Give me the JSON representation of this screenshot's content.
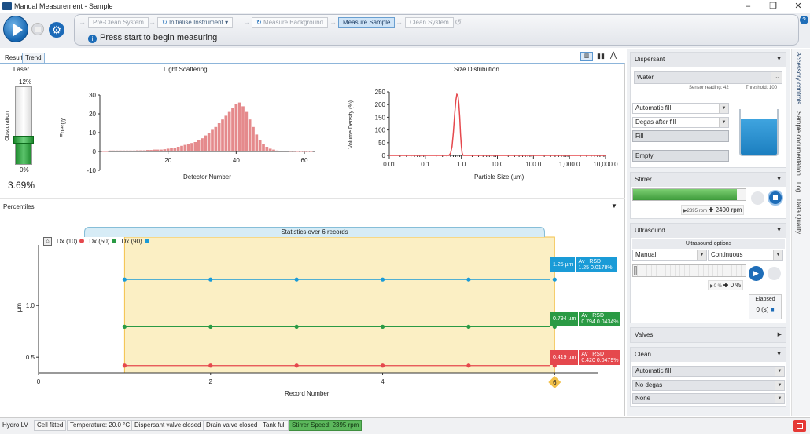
{
  "window": {
    "title": "Manual Measurement - Sample"
  },
  "workflow": {
    "steps": [
      "Pre-Clean System",
      "Initialise Instrument",
      "Measure Background",
      "Measure Sample",
      "Clean System"
    ],
    "active_step": "Measure Sample",
    "instruction": "Press start to begin measuring"
  },
  "tabs": {
    "result": "Result",
    "trend": "Trend"
  },
  "laser": {
    "title": "Laser",
    "top_pct": "12%",
    "bottom_pct": "0%",
    "obscuration_label": "Obscuration",
    "value": "3.69%",
    "level": 0.3075
  },
  "light_scattering": {
    "title": "Light Scattering",
    "ylabel": "Energy",
    "xlabel": "Detector Number"
  },
  "size_distribution": {
    "title": "Size Distribution",
    "ylabel": "Volume Density (%)",
    "xlabel": "Particle Size (µm)"
  },
  "percentiles": {
    "title": "Percentiles",
    "banner": "Statistics over 6 records",
    "legend": [
      "Dx (10)",
      "Dx (50)",
      "Dx (90)"
    ],
    "xlabel": "Record Number",
    "ylabel": "µm",
    "marker_label": "6",
    "stats": [
      {
        "value": "1.25 µm",
        "av_label": "Av",
        "rsd_label": "RSD",
        "av": "1.25",
        "rsd": "0.0178%",
        "color": "#1a9bd7"
      },
      {
        "value": "0.794 µm",
        "av_label": "Av",
        "rsd_label": "RSD",
        "av": "0.794",
        "rsd": "0.0434%",
        "color": "#2a9a44"
      },
      {
        "value": "0.419 µm",
        "av_label": "Av",
        "rsd_label": "RSD",
        "av": "0.420",
        "rsd": "0.0479%",
        "color": "#e5484d"
      }
    ]
  },
  "chart_data": [
    {
      "type": "bar",
      "title": "Light Scattering",
      "xlabel": "Detector Number",
      "ylabel": "Energy",
      "xlim": [
        0,
        63
      ],
      "ylim": [
        -10,
        30
      ],
      "xticks": [
        20,
        40,
        60
      ],
      "yticks": [
        -10,
        0,
        10,
        20,
        30
      ],
      "x": [
        1,
        2,
        3,
        4,
        5,
        6,
        7,
        8,
        9,
        10,
        11,
        12,
        13,
        14,
        15,
        16,
        17,
        18,
        19,
        20,
        21,
        22,
        23,
        24,
        25,
        26,
        27,
        28,
        29,
        30,
        31,
        32,
        33,
        34,
        35,
        36,
        37,
        38,
        39,
        40,
        41,
        42,
        43,
        44,
        45,
        46,
        47,
        48,
        49,
        50,
        51,
        52,
        53,
        54,
        55,
        56,
        57,
        58,
        59,
        60,
        61,
        62
      ],
      "values": [
        0,
        0,
        0.5,
        0.5,
        0.5,
        0.5,
        0.5,
        0.5,
        0.5,
        0.5,
        0.6,
        0.6,
        0.6,
        0.8,
        0.8,
        1,
        1,
        1,
        1.2,
        1.5,
        2,
        2,
        2.5,
        3,
        3.5,
        4,
        4.5,
        5,
        6,
        7,
        8.5,
        10,
        11.5,
        13,
        15,
        17,
        19,
        21,
        23,
        25,
        26,
        24,
        21,
        17,
        13,
        9,
        6,
        4,
        2.5,
        1.5,
        1,
        0.5,
        0.3,
        0.2,
        0.2,
        0.1,
        0.1,
        0,
        0,
        0,
        0,
        0
      ]
    },
    {
      "type": "line",
      "title": "Size Distribution",
      "xlabel": "Particle Size (µm)",
      "ylabel": "Volume Density (%)",
      "xscale": "log",
      "xlim": [
        0.01,
        10000
      ],
      "ylim": [
        0,
        250
      ],
      "xticks": [
        "0.01",
        "0.1",
        "1.0",
        "10.0",
        "100.0",
        "1,000.0",
        "10,000.0"
      ],
      "yticks": [
        0,
        50,
        100,
        150,
        200,
        250
      ],
      "x": [
        0.45,
        0.5,
        0.55,
        0.6,
        0.65,
        0.7,
        0.75,
        0.8,
        0.85,
        0.9,
        0.95,
        1.0,
        1.05,
        1.1,
        1.15
      ],
      "values": [
        0,
        8,
        35,
        90,
        160,
        215,
        240,
        238,
        205,
        150,
        85,
        35,
        10,
        2,
        0
      ]
    },
    {
      "type": "line",
      "title": "Percentiles",
      "xlabel": "Record Number",
      "ylabel": "µm",
      "xlim": [
        0,
        6.5
      ],
      "ylim": [
        0.35,
        1.6
      ],
      "xticks": [
        0,
        2,
        4,
        6
      ],
      "yticks": [
        0.5,
        1.0
      ],
      "x": [
        1,
        2,
        3,
        4,
        5,
        6
      ],
      "series": [
        {
          "name": "Dx (10)",
          "color": "#e5484d",
          "values": [
            0.42,
            0.42,
            0.42,
            0.42,
            0.42,
            0.42
          ]
        },
        {
          "name": "Dx (50)",
          "color": "#2a9a44",
          "values": [
            0.794,
            0.794,
            0.794,
            0.794,
            0.794,
            0.794
          ]
        },
        {
          "name": "Dx (90)",
          "color": "#1a9bd7",
          "values": [
            1.25,
            1.25,
            1.25,
            1.25,
            1.25,
            1.25
          ]
        }
      ]
    }
  ],
  "dispersant": {
    "title": "Dispersant",
    "name": "Water",
    "sensor_reading": "Sensor reading: 42",
    "threshold": "Threshold: 100",
    "fill_mode": "Automatic fill",
    "degas": "Degas after fill",
    "fill_btn": "Fill",
    "empty_btn": "Empty"
  },
  "stirrer": {
    "title": "Stirrer",
    "actual": "2395 rpm",
    "target": "2400",
    "unit": "rpm",
    "level": 0.92
  },
  "ultrasound": {
    "title": "Ultrasound",
    "options_label": "Ultrasound options",
    "mode": "Manual",
    "duty": "Continuous",
    "actual": "0 %",
    "target": "0",
    "unit": "%",
    "elapsed_label": "Elapsed",
    "elapsed": "0 (s)"
  },
  "valves": {
    "title": "Valves"
  },
  "clean": {
    "title": "Clean",
    "fill": "Automatic fill",
    "degas": "No degas",
    "other": "None"
  },
  "side_tabs": [
    "Accessory controls",
    "Sample documentation",
    "Log",
    "Data Quality"
  ],
  "status_bar": [
    "Hydro LV",
    "Cell fitted",
    "Temperature: 20.0 °C",
    "Dispersant valve closed",
    "Drain valve closed",
    "Tank full",
    "Stirrer Speed: 2395 rpm"
  ],
  "colors": {
    "accent": "#1e6db8",
    "stat_bg": "#fbefc4",
    "stat_border": "#f3c14a",
    "bar": "#e58a8c"
  }
}
